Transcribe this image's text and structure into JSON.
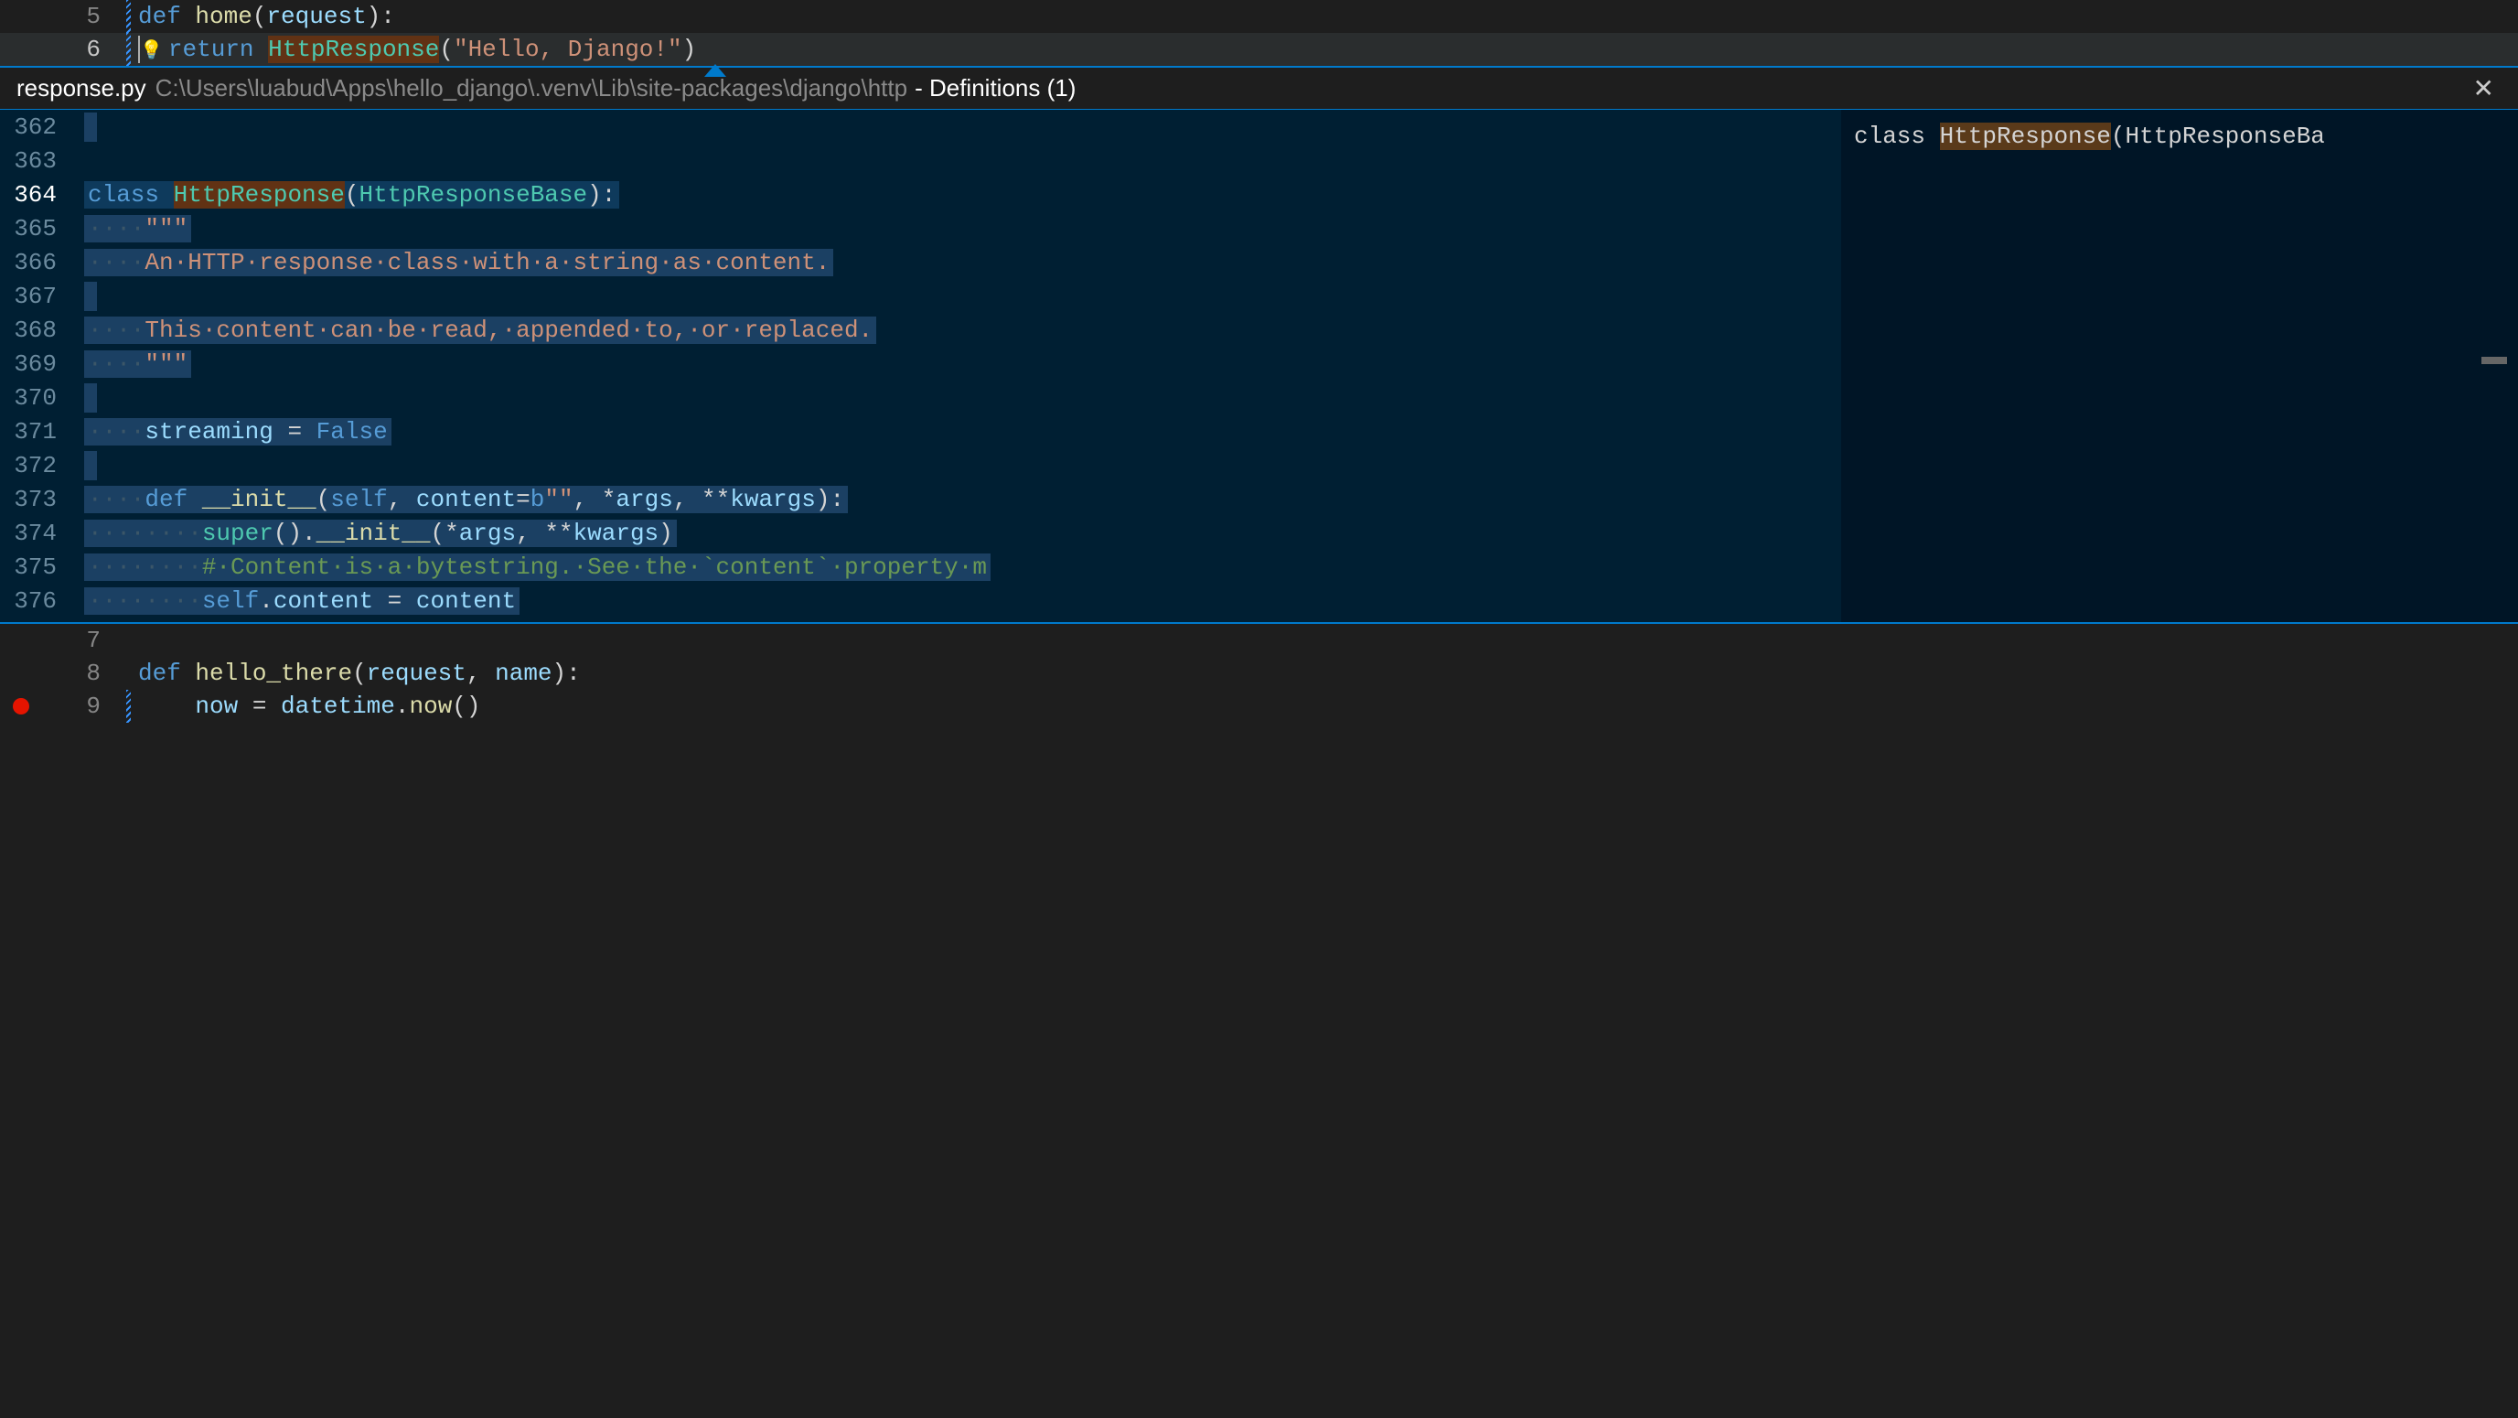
{
  "main_editor": {
    "lines": [
      {
        "num": "5",
        "modified": true
      },
      {
        "num": "6",
        "modified": true,
        "highlighted": true,
        "lightbulb": true
      }
    ],
    "line5": {
      "def": "def ",
      "func": "home",
      "paren_open": "(",
      "param": "request",
      "paren_close": "):"
    },
    "line6": {
      "indent": "    ",
      "return": "return ",
      "class": "HttpResponse",
      "paren_open": "(",
      "string": "\"Hello, Django!\"",
      "paren_close": ")"
    },
    "bottom_lines": [
      {
        "num": "7",
        "content": ""
      },
      {
        "num": "8"
      },
      {
        "num": "9",
        "modified": true,
        "breakpoint": true
      }
    ],
    "line8": {
      "def": "def ",
      "func": "hello_there",
      "paren_open": "(",
      "param1": "request",
      "comma": ", ",
      "param2": "name",
      "paren_close": "):"
    },
    "line9": {
      "indent": "    ",
      "var": "now",
      "eq": " = ",
      "mod": "datetime",
      "dot": ".",
      "func": "now",
      "paren": "()"
    }
  },
  "peek": {
    "filename": "response.py",
    "filepath": "C:\\Users\\luabud\\Apps\\hello_django\\.venv\\Lib\\site-packages\\django\\http",
    "dash": " - ",
    "title": "Definitions (1)",
    "ref_prefix": "class ",
    "ref_highlight": "HttpResponse",
    "ref_suffix": "(HttpResponseBa",
    "lines": {
      "362": "",
      "363": "",
      "364": {
        "class_kw": "class ",
        "name": "HttpResponse",
        "paren_open": "(",
        "base": "HttpResponseBase",
        "paren_close": "):"
      },
      "365": {
        "indent4": "····",
        "docq": "\"\"\""
      },
      "366": {
        "indent4": "····",
        "text": "An·HTTP·response·class·with·a·string·as·content."
      },
      "367": "",
      "368": {
        "indent4": "····",
        "text": "This·content·can·be·read,·appended·to,·or·replaced."
      },
      "369": {
        "indent4": "····",
        "docq": "\"\"\""
      },
      "370": "",
      "371": {
        "indent4": "····",
        "var": "streaming",
        "eq": " = ",
        "val": "False"
      },
      "372": "",
      "373": {
        "indent4": "····",
        "def": "def ",
        "func": "__init__",
        "args": "(",
        "self": "self",
        "c1": ", ",
        "p1": "content",
        "eq1": "=",
        "b": "b",
        "bs": "\"\"",
        "c2": ", *",
        "args_p": "args",
        "c3": ", **",
        "kwargs_p": "kwargs",
        "close": "):"
      },
      "374": {
        "indent8": "········",
        "super": "super",
        "paren1": "().",
        "init": "__init__",
        "paren2": "(*",
        "args_p": "args",
        "c1": ", **",
        "kwargs_p": "kwargs",
        "close": ")"
      },
      "375": {
        "indent8": "········",
        "comment": "#·Content·is·a·bytestring.·See·the·`content`·property·m"
      },
      "376": {
        "indent8": "········",
        "self": "self",
        "dot": ".",
        "attr": "content",
        "eq": " = ",
        "val": "content"
      },
      "377": ""
    }
  }
}
